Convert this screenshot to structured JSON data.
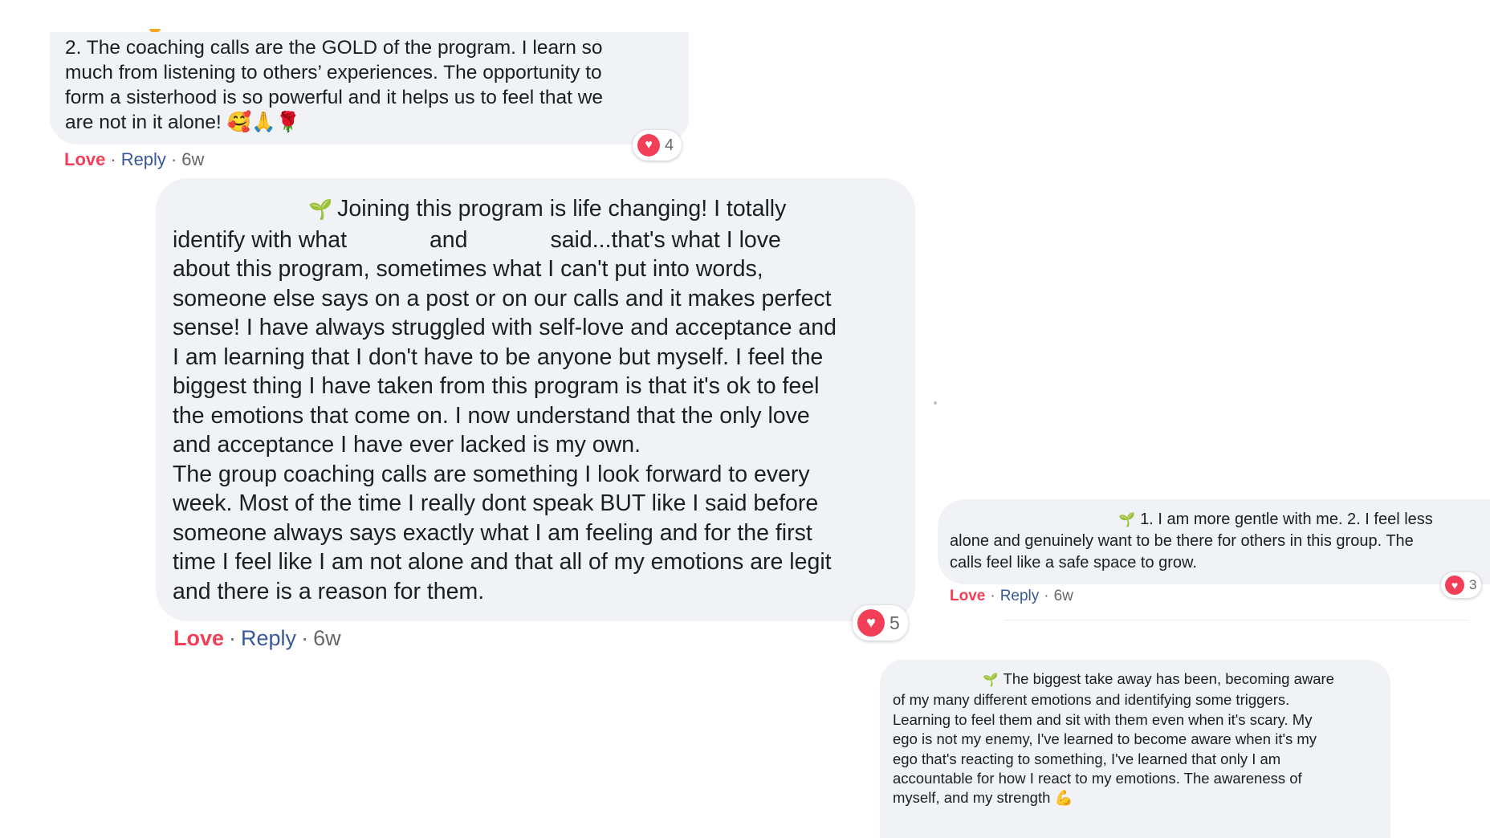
{
  "comments": [
    {
      "text_lines": [
        "2. The coaching calls are the GOLD of the program. I learn so",
        "much from listening to others’ experiences. The opportunity to",
        "form a sisterhood is so powerful and it helps us to feel that we",
        "are not in it alone! 🥰🙏🌹"
      ],
      "reaction_count": "4",
      "love": "Love",
      "reply": "Reply",
      "time": "6w"
    },
    {
      "text_lines": [
        "Joining this program is life changing! I totally",
        "identify with what             and             said...that's what I love",
        "about this program, sometimes what I can't put into words,",
        "someone else says on a post or on our calls and it makes perfect",
        "sense! I have always struggled with self-love and acceptance and",
        "I am learning that I don't have to be anyone but myself. I feel the",
        "biggest thing I have taken from this program is that it's ok to feel",
        "the emotions that come on. I now understand that the only love",
        "and acceptance I have ever lacked is my own.",
        "The group coaching calls are something I look forward to every",
        "week. Most of the time I really dont speak BUT like I said before",
        "someone always says exactly what I am feeling and for the first",
        "time I feel like I am not alone and that all of my emotions are legit",
        "and there is a reason for them."
      ],
      "reaction_count": "5",
      "love": "Love",
      "reply": "Reply",
      "time": "6w"
    },
    {
      "text_lines": [
        "1. I am more gentle with me. 2. I feel less",
        "alone and genuinely want to be there for others in this group. The",
        "calls feel like a safe space to grow."
      ],
      "reaction_count": "3",
      "love": "Love",
      "reply": "Reply",
      "time": "6w"
    },
    {
      "text_lines": [
        "The biggest take away has been, becoming aware",
        "of my many different emotions and identifying some triggers.",
        "Learning to feel them and sit with them even when it's scary. My",
        "ego is not my enemy, I've learned to become aware when it's my",
        "ego that's reacting to something, I've learned that only I am",
        "accountable for how I react to my emotions. The awareness of",
        "myself, and my strength 💪"
      ]
    }
  ],
  "icons": {
    "sprout": "sprout-icon",
    "reaction": "heart-icon"
  },
  "colors": {
    "bubble": "#f0f2f5",
    "love": "#f33e58",
    "reply": "#385898",
    "meta": "#65676b"
  }
}
